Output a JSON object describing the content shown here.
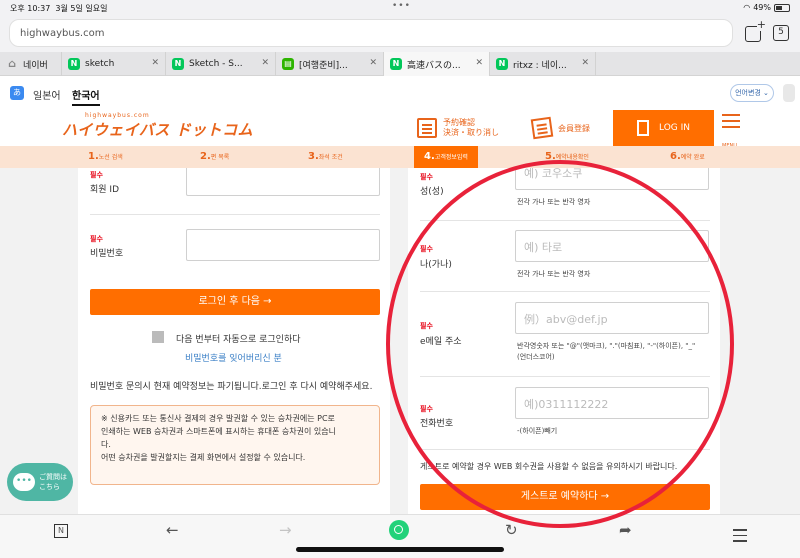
{
  "status_bar": {
    "time": "오후 10:37",
    "date": "3월 5일 일요일",
    "battery": "49%"
  },
  "browser": {
    "url": "highwaybus.com",
    "tab_count": "5",
    "tabs": [
      {
        "label": "네이버",
        "icon": "home-icon"
      },
      {
        "label": "sketch",
        "icon": "naver-n-icon"
      },
      {
        "label": "Sketch - S...",
        "icon": "naver-n-icon"
      },
      {
        "label": "[여행준비]...",
        "icon": "blog-icon"
      },
      {
        "label": "高速バスの...",
        "icon": "naver-n-icon",
        "active": true
      },
      {
        "label": "ritxz : 네이...",
        "icon": "naver-n-icon"
      }
    ]
  },
  "site": {
    "lang_ja": "일본어",
    "lang_ko": "한국어",
    "lang_change": "언어변경",
    "logo_small": "highwaybus.com",
    "logo": "ハイウェイバス ドットコム",
    "reserve_line1": "予約確認",
    "reserve_line2": "決済・取り消し",
    "member": "会員登録",
    "login": "LOG IN",
    "menu": "MENU"
  },
  "steps": [
    {
      "num": "1.",
      "label": "노선 검색"
    },
    {
      "num": "2.",
      "label": "편 목록"
    },
    {
      "num": "3.",
      "label": "좌석 조건"
    },
    {
      "num": "4.",
      "label": "고객정보입력"
    },
    {
      "num": "5.",
      "label": "예약내용확인"
    },
    {
      "num": "6.",
      "label": "예약 완료"
    }
  ],
  "login_panel": {
    "required": "필수",
    "member_id_label": "회원 ID",
    "password_label": "비밀번호",
    "login_next": "로그인 후 다음 →",
    "auto_login": "다음 번부터 자동으로 로그인하다",
    "forgot_password": "비밀번호를 잊어버리신 분",
    "notice": "비밀번호 문의시 현재 예약정보는 파기됩니다.로그인 후 다시 예약해주세요.",
    "warning_lines": [
      "※ 신용카드 또는 통신사 결제의 경우 발권할 수 있는 승차권에는 PC로",
      "인쇄하는 WEB 승차권과 스마트폰에 표시하는 휴대폰 승차권이 있습니",
      "다.",
      "어떤 승차권을 발권할지는 결제 화면에서 설정할 수 있습니다."
    ]
  },
  "guest_panel": {
    "required": "필수",
    "surname_label": "성(성)",
    "surname_placeholder": "예) 코우소쿠",
    "surname_hint": "전각 가나 또는 반각 영자",
    "name_label": "나(가나)",
    "name_placeholder": "예) 타로",
    "name_hint": "전각 가나 또는 반각 영자",
    "email_label": "e메일 주소",
    "email_placeholder": "例）abv@def.jp",
    "email_hint_1": "반각영숫자 또는 \"@\"(앳마크), \".\"(마침표), \"-\"(하이픈), \"_\"",
    "email_hint_2": "(언더스코어)",
    "phone_label": "전화번호",
    "phone_placeholder": "예)0311112222",
    "phone_hint": "-(하이픈)빼기",
    "guest_notice": "게스트로 예약할 경우 WEB 회수권을 사용할 수 없음을 유의하시기 바랍니다.",
    "guest_reserve": "게스트로 예약하다 →"
  },
  "help_bubble": {
    "line1": "ご質問は",
    "line2": "こちら"
  },
  "toolbar": {
    "n_label": "N"
  },
  "colors": {
    "accent": "#ff6e00",
    "annotation": "#e8223a",
    "required": "#e60012"
  }
}
